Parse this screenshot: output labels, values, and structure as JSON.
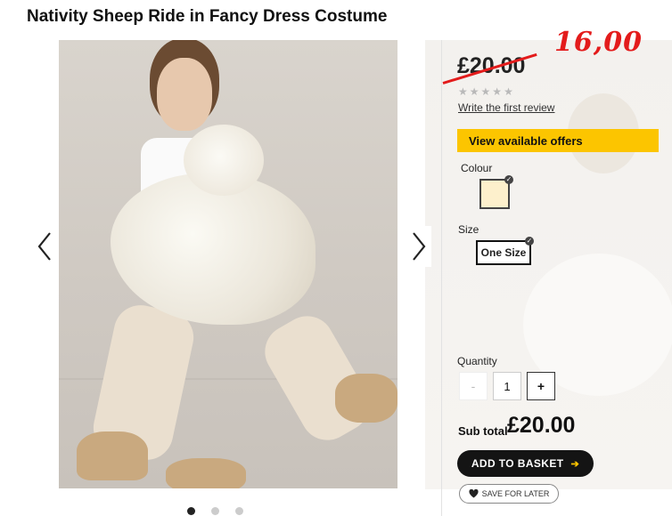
{
  "product": {
    "title": "Nativity Sheep Ride in Fancy Dress Costume",
    "old_price": "£20.00",
    "new_price_annotation": "16,00",
    "rating_stars": 0,
    "review_link": "Write the first review",
    "offers_label": "View available offers"
  },
  "options": {
    "colour_label": "Colour",
    "size_label": "Size",
    "size_value": "One Size"
  },
  "quantity": {
    "label": "Quantity",
    "minus": "-",
    "value": "1",
    "plus": "+"
  },
  "subtotal": {
    "label": "Sub total",
    "value": "£20.00"
  },
  "actions": {
    "basket_label": "ADD TO BASKET",
    "save_label": "SAVE FOR LATER"
  },
  "carousel": {
    "total_images": 3,
    "active_index": 0
  },
  "colors": {
    "accent_yellow": "#fcc500",
    "annotation_red": "#e31b1b",
    "swatch": "#fdf0cc"
  }
}
